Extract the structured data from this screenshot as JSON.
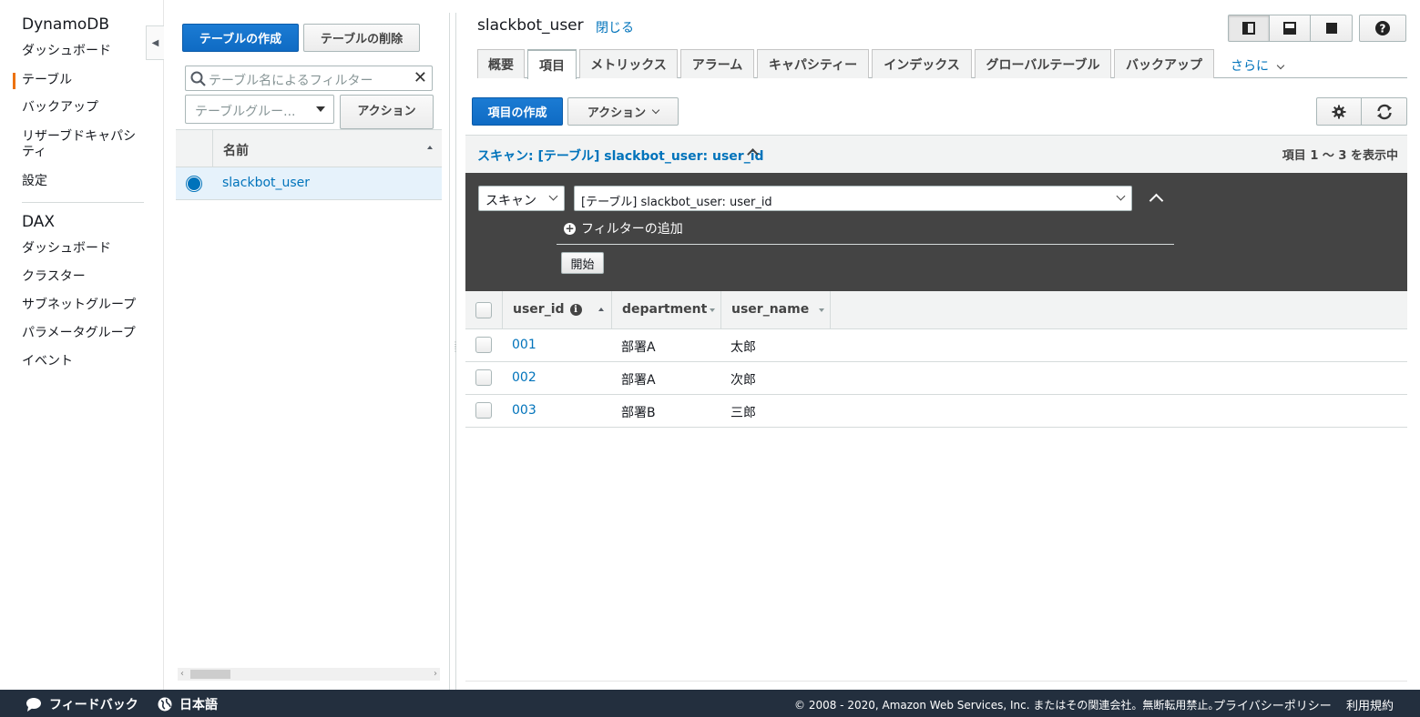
{
  "leftnav": {
    "dynamodb_title": "DynamoDB",
    "dynamodb_items": [
      {
        "label": "ダッシュボード"
      },
      {
        "label": "テーブル"
      },
      {
        "label": "バックアップ"
      },
      {
        "label": "リザーブドキャパシティ"
      },
      {
        "label": "設定"
      }
    ],
    "dax_title": "DAX",
    "dax_items": [
      {
        "label": "ダッシュボード"
      },
      {
        "label": "クラスター"
      },
      {
        "label": "サブネットグループ"
      },
      {
        "label": "パラメータグループ"
      },
      {
        "label": "イベント"
      }
    ],
    "active_item": "テーブル"
  },
  "tablelist": {
    "create_label": "テーブルの作成",
    "delete_label": "テーブルの削除",
    "filter_placeholder": "テーブル名によるフィルター",
    "group_placeholder": "テーブルグルー...",
    "actions_label": "アクション",
    "column_header": "名前",
    "tables": [
      {
        "name": "slackbot_user",
        "selected": true
      }
    ]
  },
  "main": {
    "title": "slackbot_user",
    "close_label": "閉じる",
    "tabs": [
      {
        "label": "概要"
      },
      {
        "label": "項目"
      },
      {
        "label": "メトリックス"
      },
      {
        "label": "アラーム"
      },
      {
        "label": "キャパシティー"
      },
      {
        "label": "インデックス"
      },
      {
        "label": "グローバルテーブル"
      },
      {
        "label": "バックアップ"
      }
    ],
    "selected_tab": "項目",
    "more_label": "さらに",
    "create_item_label": "項目の作成",
    "actions_label": "アクション",
    "scan_title": "スキャン: [テーブル] slackbot_user: user_id",
    "result_count": "項目 1 〜 3 を表示中",
    "scan_mode": "スキャン",
    "scan_target": "[テーブル] slackbot_user: user_id",
    "add_filter_label": "フィルターの追加",
    "start_label": "開始",
    "columns": [
      "user_id",
      "department",
      "user_name"
    ],
    "rows": [
      {
        "user_id": "001",
        "department": "部署A",
        "user_name": "太郎"
      },
      {
        "user_id": "002",
        "department": "部署A",
        "user_name": "次郎"
      },
      {
        "user_id": "003",
        "department": "部署B",
        "user_name": "三郎"
      }
    ]
  },
  "footer": {
    "feedback": "フィードバック",
    "language": "日本語",
    "copyright": "© 2008 - 2020, Amazon Web Services, Inc. またはその関連会社。無断転用禁止。",
    "privacy": "プライバシーポリシー",
    "terms": "利用規約"
  },
  "colors": {
    "accent": "#ec7211",
    "link": "#0073bb",
    "primary_button": "#0f6bc4",
    "footer_bg": "#232f3e",
    "scan_panel_bg": "#444444"
  }
}
